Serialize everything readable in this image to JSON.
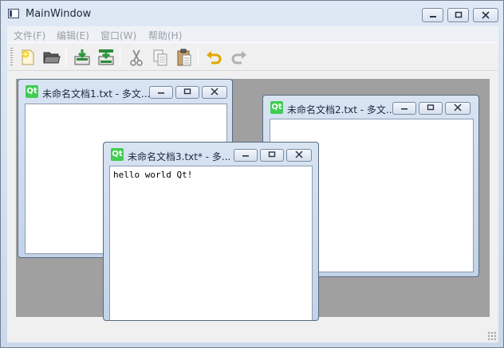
{
  "window": {
    "title": "MainWindow"
  },
  "menu": [
    {
      "label": "文件(F)"
    },
    {
      "label": "编辑(E)"
    },
    {
      "label": "窗口(W)"
    },
    {
      "label": "帮助(H)"
    }
  ],
  "toolbar": [
    {
      "icon": "new-file-icon"
    },
    {
      "icon": "open-folder-icon"
    },
    {
      "icon": "save-icon"
    },
    {
      "icon": "save-as-icon"
    },
    {
      "icon": "cut-icon"
    },
    {
      "icon": "copy-icon"
    },
    {
      "icon": "paste-icon"
    },
    {
      "icon": "undo-icon"
    },
    {
      "icon": "redo-icon"
    }
  ],
  "subwindows": [
    {
      "title": "未命名文档1.txt - 多文...",
      "text": ""
    },
    {
      "title": "未命名文档2.txt - 多文...",
      "text": ""
    },
    {
      "title": "未命名文档3.txt* - 多...",
      "text": "hello world Qt!"
    }
  ],
  "colors": {
    "qt_green": "#41cd52",
    "mdi_background": "#a0a0a0"
  }
}
